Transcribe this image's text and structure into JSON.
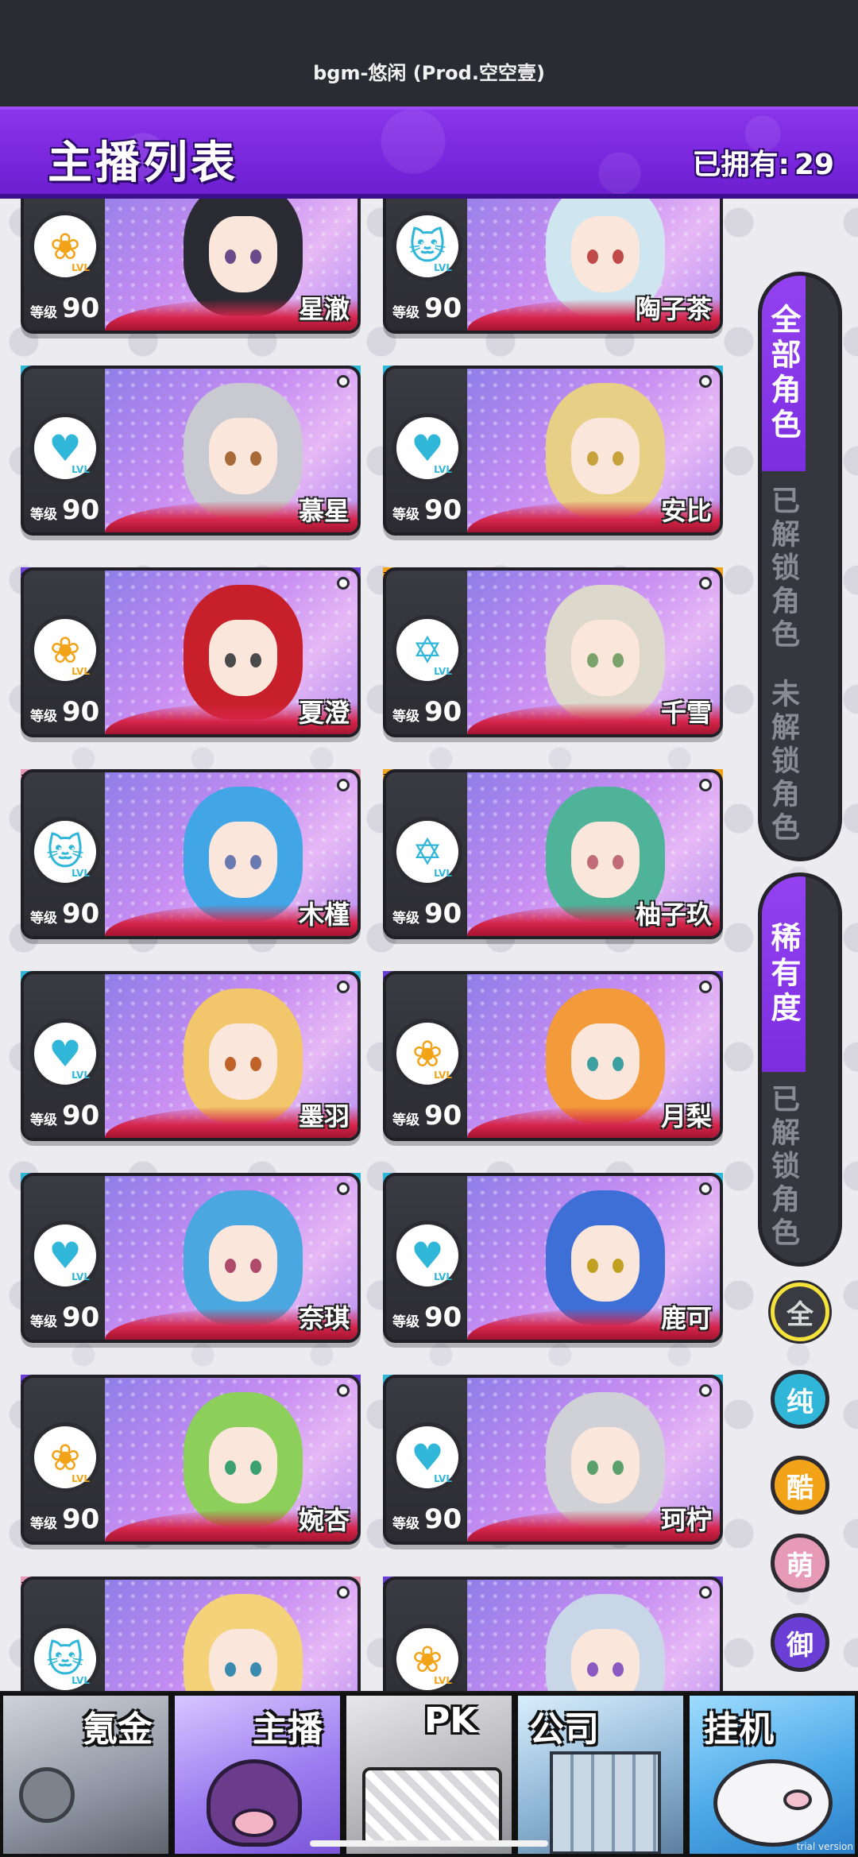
{
  "top_bar": {
    "music": "bgm-悠闲 (Prod.空空壹)"
  },
  "header": {
    "title": "主播列表",
    "owned_label": "已拥有:",
    "owned_count": "29"
  },
  "colors": {
    "chun": "#2fb6d8",
    "yu": "#6b3fd6",
    "ku": "#f2a318",
    "meng": "#e79ab6",
    "accent": "#8a35ea",
    "red": "#d6254a"
  },
  "cards": [
    {
      "name": "星澈",
      "level_label": "等级",
      "level": "90",
      "rarity": "",
      "emblem": "rose-icon"
    },
    {
      "name": "陶子茶",
      "level_label": "等级",
      "level": "90",
      "rarity": "",
      "emblem": "cat-icon"
    },
    {
      "name": "慕星",
      "level_label": "等级",
      "level": "90",
      "rarity": "纯",
      "emblem": "heart-pulse-icon"
    },
    {
      "name": "安比",
      "level_label": "等级",
      "level": "90",
      "rarity": "纯",
      "emblem": "heart-pulse-icon"
    },
    {
      "name": "夏澄",
      "level_label": "等级",
      "level": "90",
      "rarity": "御",
      "emblem": "rose-icon"
    },
    {
      "name": "千雪",
      "level_label": "等级",
      "level": "90",
      "rarity": "酷",
      "emblem": "star-icon"
    },
    {
      "name": "木槿",
      "level_label": "等级",
      "level": "90",
      "rarity": "萌",
      "emblem": "cat-icon"
    },
    {
      "name": "柚子玖",
      "level_label": "等级",
      "level": "90",
      "rarity": "酷",
      "emblem": "star-icon"
    },
    {
      "name": "墨羽",
      "level_label": "等级",
      "level": "90",
      "rarity": "纯",
      "emblem": "heart-pulse-icon"
    },
    {
      "name": "月梨",
      "level_label": "等级",
      "level": "90",
      "rarity": "御",
      "emblem": "rose-icon"
    },
    {
      "name": "奈琪",
      "level_label": "等级",
      "level": "90",
      "rarity": "纯",
      "emblem": "heart-pulse-icon"
    },
    {
      "name": "鹿可",
      "level_label": "等级",
      "level": "90",
      "rarity": "纯",
      "emblem": "heart-pulse-icon"
    },
    {
      "name": "婉杏",
      "level_label": "等级",
      "level": "90",
      "rarity": "御",
      "emblem": "rose-icon"
    },
    {
      "name": "珂柠",
      "level_label": "等级",
      "level": "90",
      "rarity": "纯",
      "emblem": "heart-pulse-icon"
    },
    {
      "name": "",
      "level_label": "",
      "level": "",
      "rarity": "萌",
      "emblem": "cat-icon"
    },
    {
      "name": "",
      "level_label": "",
      "level": "",
      "rarity": "御",
      "emblem": "rose-icon"
    }
  ],
  "emblem_tag": "LVL",
  "sidebar": {
    "character_filter": {
      "active": "全部角色",
      "options": [
        "已解锁角色",
        "未解锁角色"
      ]
    },
    "rarity_filter": {
      "active": "稀有度",
      "options": [
        "已解锁角色"
      ]
    },
    "type_buttons": [
      "全",
      "纯",
      "酷",
      "萌",
      "御"
    ]
  },
  "bottom_nav": [
    "氪金",
    "主播",
    "PK",
    "公司",
    "挂机"
  ],
  "watermark": "trial version"
}
